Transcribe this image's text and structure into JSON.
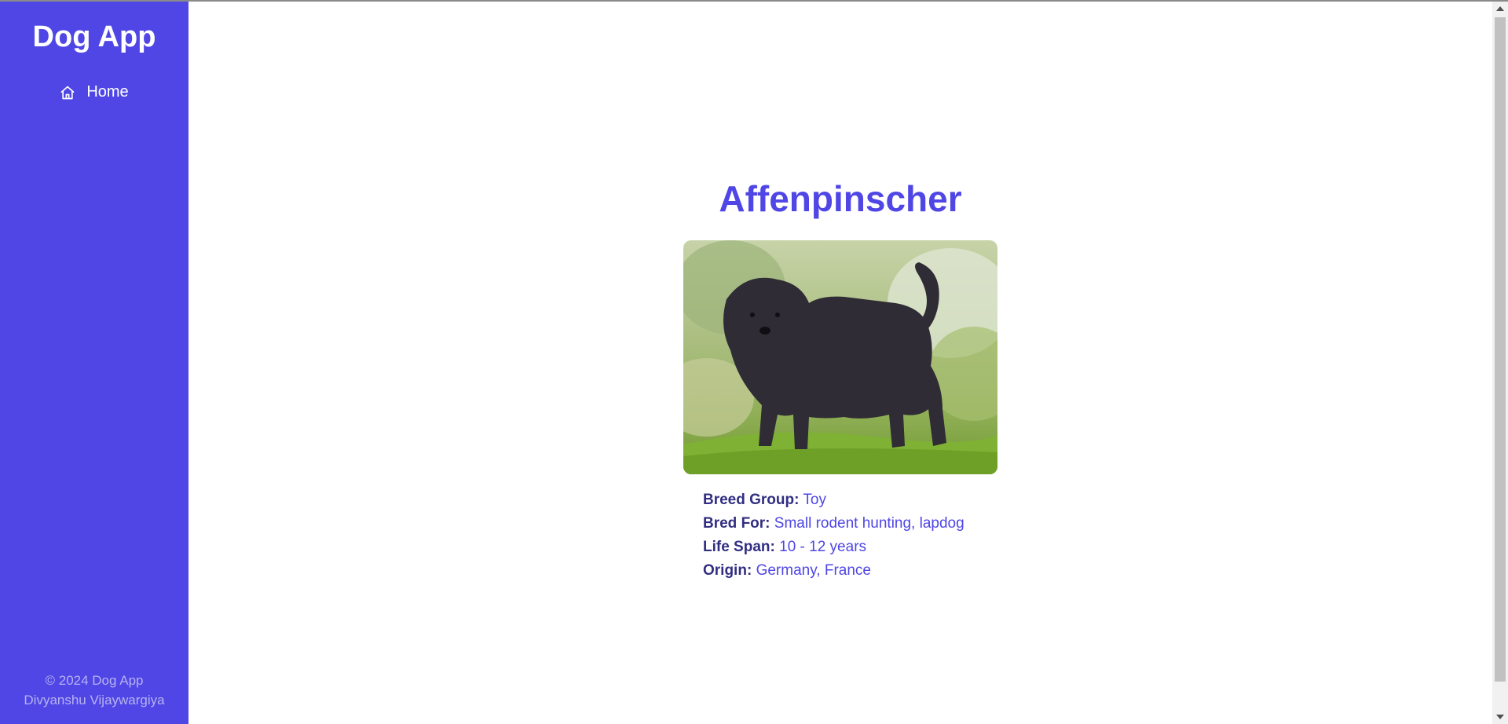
{
  "app": {
    "title": "Dog App"
  },
  "sidebar": {
    "nav": [
      {
        "label": "Home",
        "icon": "home-icon"
      }
    ],
    "footer": {
      "copyright": "© 2024 Dog App",
      "author": "Divyanshu Vijaywargiya"
    }
  },
  "breed": {
    "name": "Affenpinscher",
    "fields": [
      {
        "label": "Breed Group:",
        "value": "Toy"
      },
      {
        "label": "Bred For:",
        "value": "Small rodent hunting, lapdog"
      },
      {
        "label": "Life Span:",
        "value": "10 - 12 years"
      },
      {
        "label": "Origin:",
        "value": "Germany, France"
      }
    ]
  },
  "colors": {
    "sidebar_bg": "#4f46e5",
    "accent": "#4f46e5",
    "label_text": "#312e81",
    "footer_text": "#b7b2f2"
  }
}
